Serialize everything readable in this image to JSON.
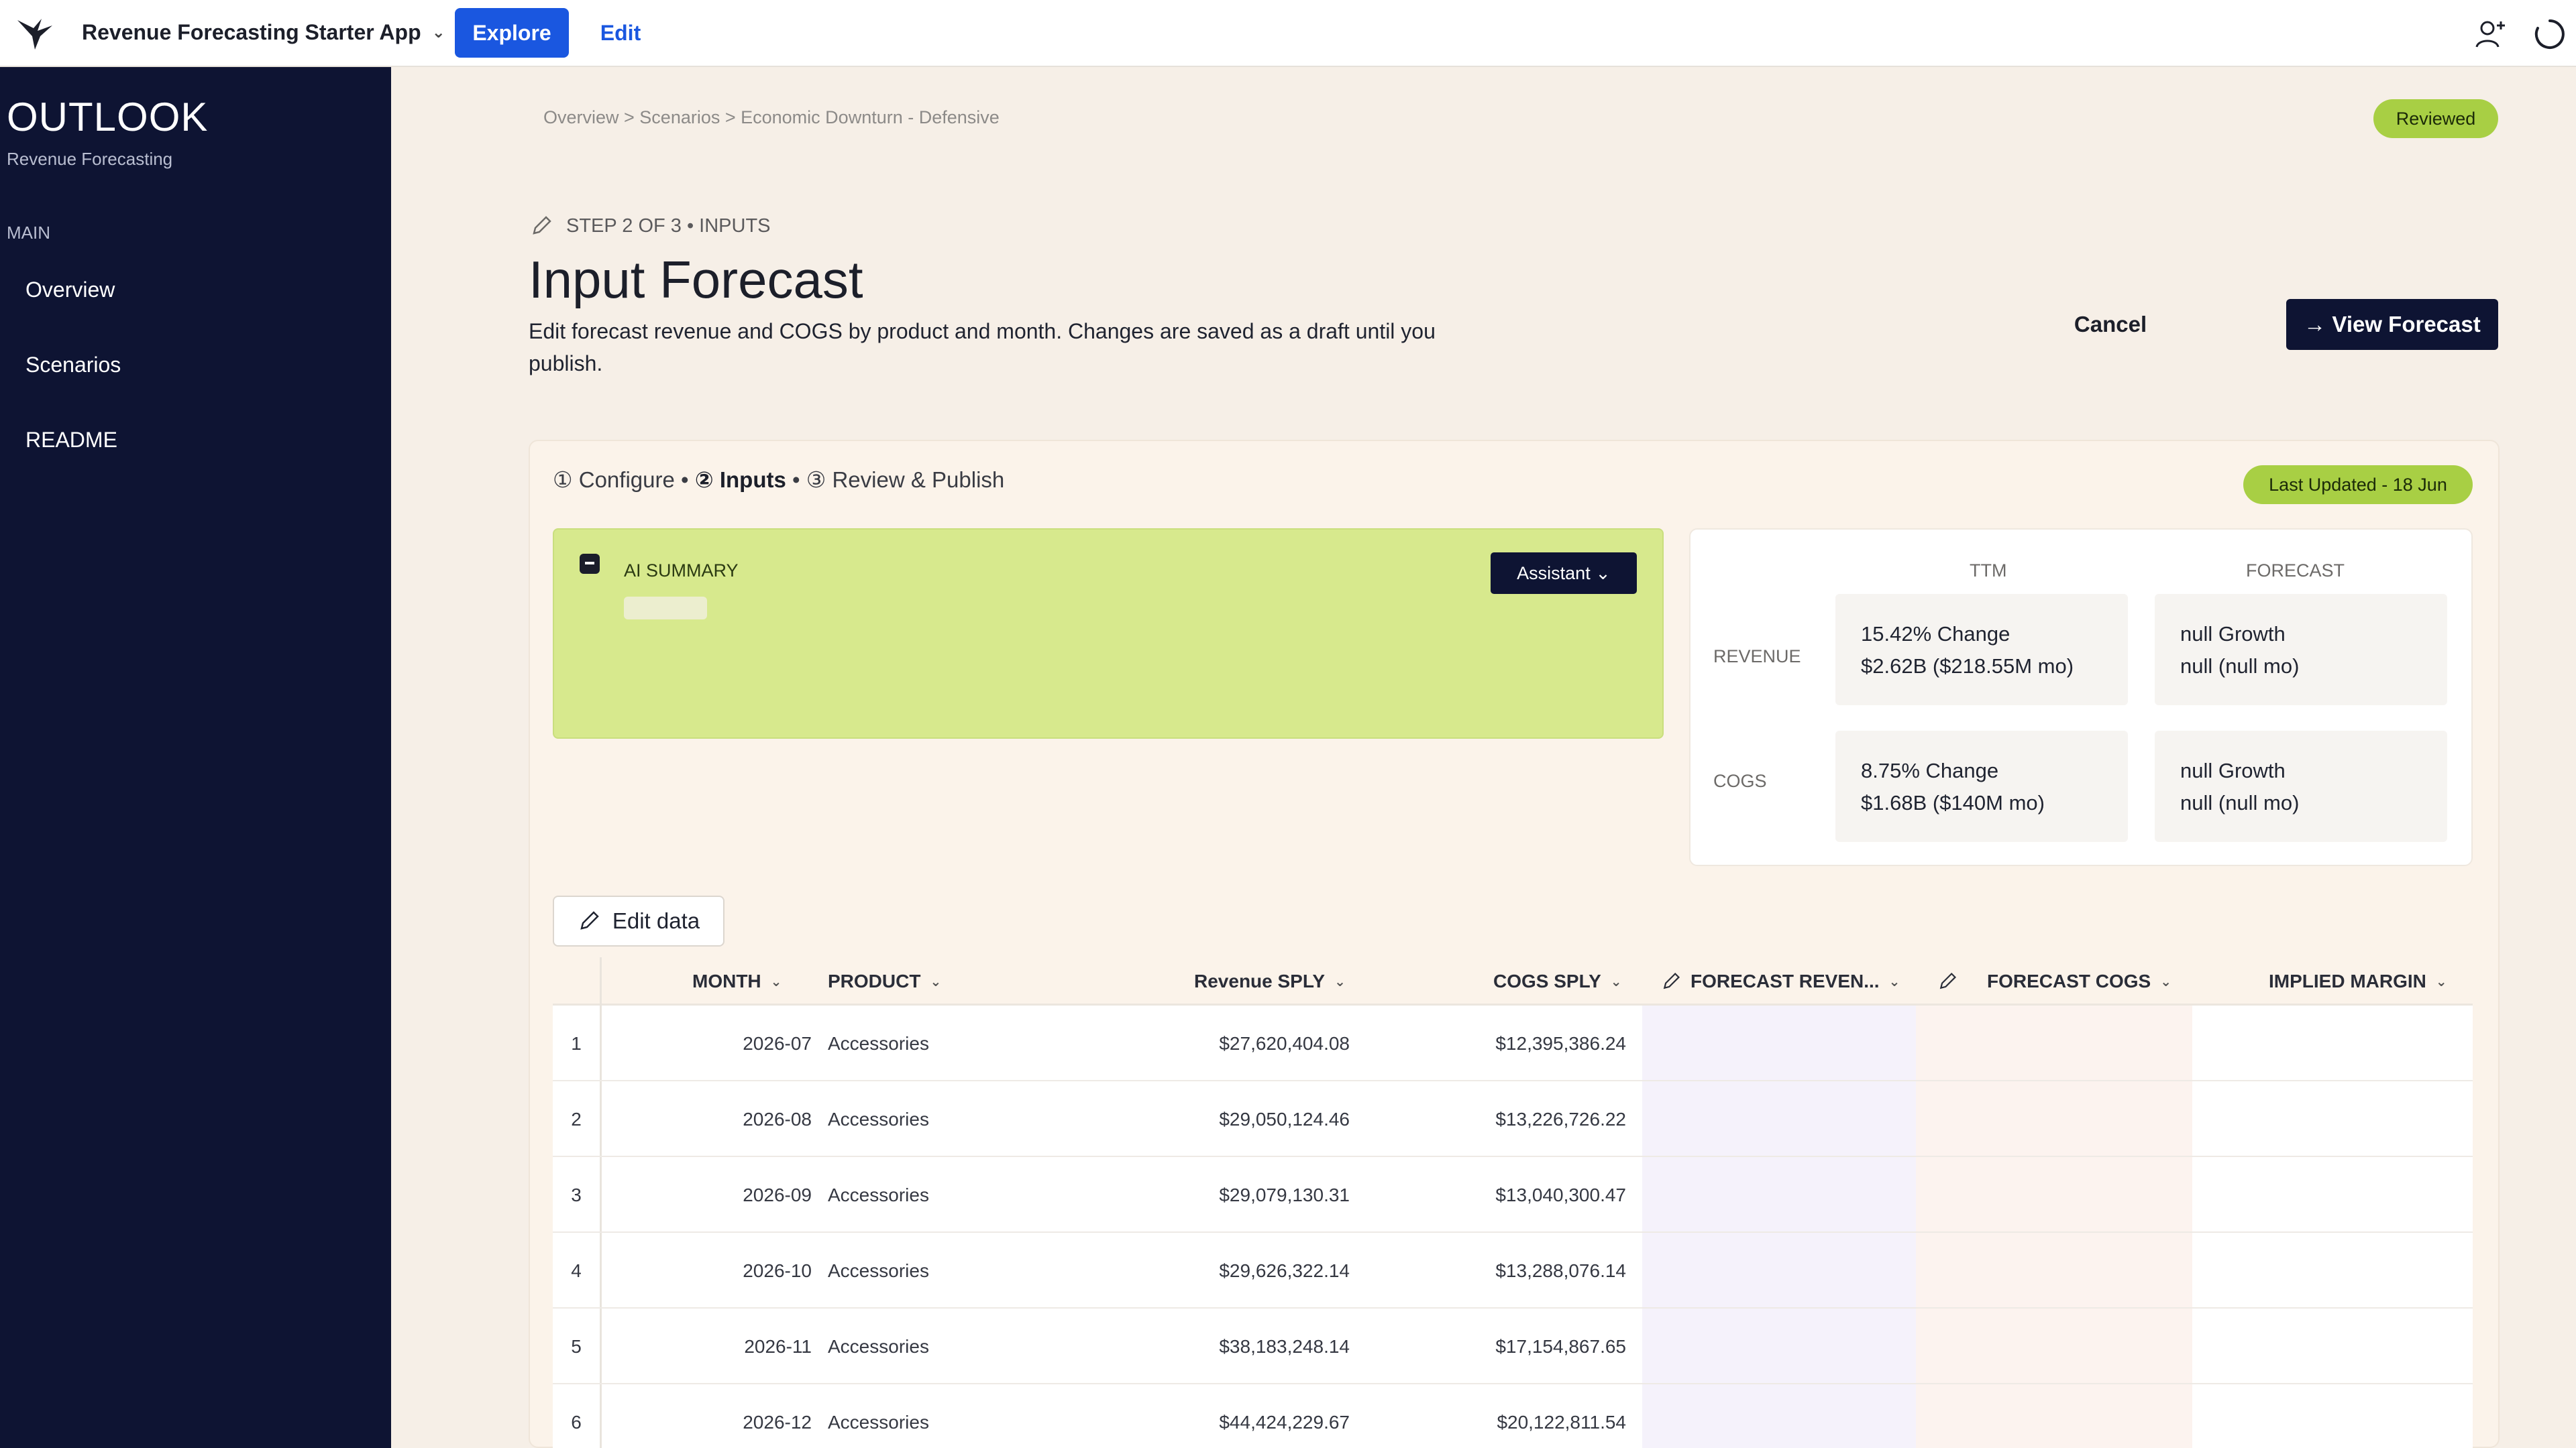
{
  "topbar": {
    "app_title": "Revenue Forecasting Starter App",
    "explore_label": "Explore",
    "edit_label": "Edit"
  },
  "sidebar": {
    "brand": "OUTLOOK",
    "brand_sub": "Revenue Forecasting",
    "section": "MAIN",
    "items": [
      {
        "label": "Overview"
      },
      {
        "label": "Scenarios"
      },
      {
        "label": "README"
      }
    ]
  },
  "page": {
    "breadcrumb": "Overview > Scenarios > Economic Downturn - Defensive",
    "status_badge": "Reviewed",
    "step_label": "STEP 2 OF 3 • INPUTS",
    "title": "Input Forecast",
    "description": "Edit forecast revenue and COGS by product and month. Changes are saved as a draft until you publish.",
    "cancel_label": "Cancel",
    "view_forecast_label": "→ View Forecast"
  },
  "stepper": {
    "step1": "① Configure",
    "sep": " • ",
    "step2": "② Inputs",
    "step3": "③ Review & Publish"
  },
  "last_updated": "Last Updated - 18 Jun",
  "ai_summary": {
    "title": "AI SUMMARY",
    "assistant_label": "Assistant ⌄"
  },
  "metrics": {
    "col_ttm": "TTM",
    "col_forecast": "FORECAST",
    "rows": [
      {
        "label": "REVENUE",
        "ttm_line1": "15.42% Change",
        "ttm_line2": "$2.62B ($218.55M mo)",
        "fc_line1": "null Growth",
        "fc_line2": "null (null mo)"
      },
      {
        "label": "COGS",
        "ttm_line1": "8.75% Change",
        "ttm_line2": "$1.68B ($140M mo)",
        "fc_line1": "null Growth",
        "fc_line2": "null (null mo)"
      }
    ]
  },
  "edit_data_label": "Edit data",
  "table": {
    "headers": {
      "month": "MONTH",
      "product": "PRODUCT",
      "revenue_sply": "Revenue SPLY",
      "cogs_sply": "COGS SPLY",
      "forecast_revenue": "FORECAST REVEN...",
      "forecast_cogs": "FORECAST COGS",
      "implied_margin": "IMPLIED MARGIN"
    },
    "rows": [
      {
        "idx": "1",
        "month": "2026-07",
        "product": "Accessories",
        "revenue_sply": "$27,620,404.08",
        "cogs_sply": "$12,395,386.24"
      },
      {
        "idx": "2",
        "month": "2026-08",
        "product": "Accessories",
        "revenue_sply": "$29,050,124.46",
        "cogs_sply": "$13,226,726.22"
      },
      {
        "idx": "3",
        "month": "2026-09",
        "product": "Accessories",
        "revenue_sply": "$29,079,130.31",
        "cogs_sply": "$13,040,300.47"
      },
      {
        "idx": "4",
        "month": "2026-10",
        "product": "Accessories",
        "revenue_sply": "$29,626,322.14",
        "cogs_sply": "$13,288,076.14"
      },
      {
        "idx": "5",
        "month": "2026-11",
        "product": "Accessories",
        "revenue_sply": "$38,183,248.14",
        "cogs_sply": "$17,154,867.65"
      },
      {
        "idx": "6",
        "month": "2026-12",
        "product": "Accessories",
        "revenue_sply": "$44,424,229.67",
        "cogs_sply": "$20,122,811.54"
      }
    ]
  },
  "colors": {
    "primary_blue": "#1a57e0",
    "navy": "#0e1433",
    "badge_green": "#a8cf44",
    "ai_panel": "#d7e98d",
    "background": "#f6efe7"
  },
  "icons": {
    "logo": "bird-logo-icon",
    "user": "add-user-icon",
    "loading": "spinner-icon",
    "pencil": "pencil-icon"
  }
}
